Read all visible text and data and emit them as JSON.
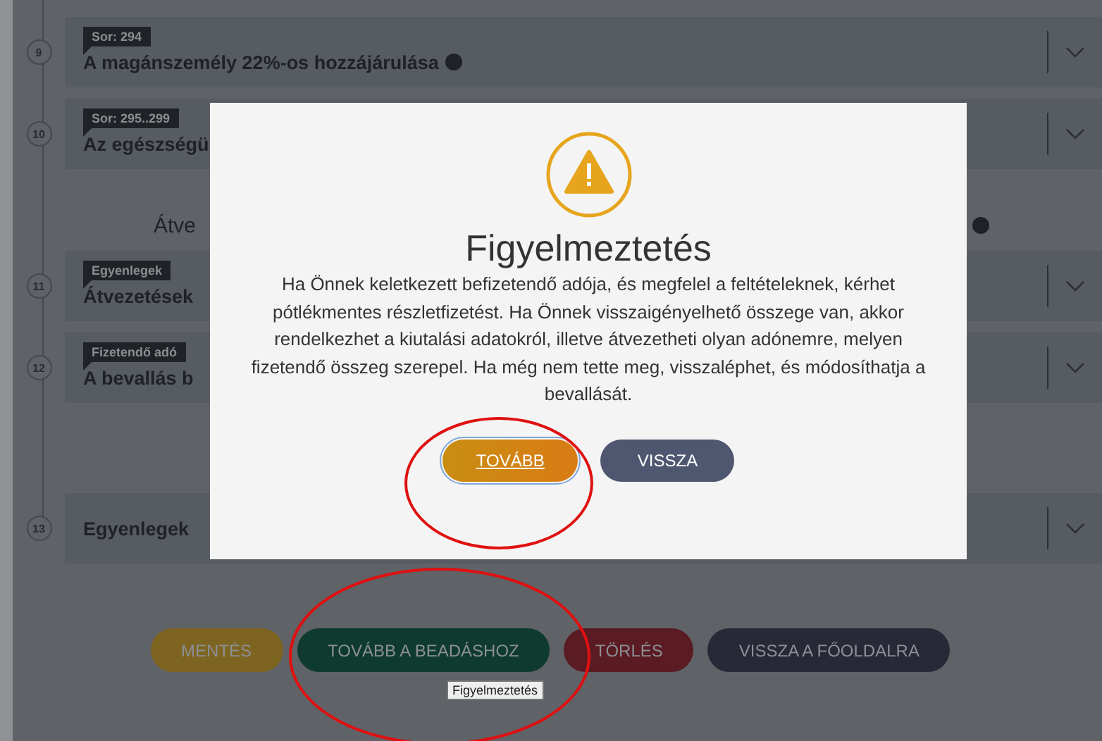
{
  "items": [
    {
      "kind": "section",
      "number": "9",
      "tag": "Sor: 294",
      "title": "A magánszemély 22%-os hozzájárulása",
      "info": true
    },
    {
      "kind": "section",
      "number": "10",
      "tag": "Sor: 295..299",
      "title": "Az egészségü",
      "info": false
    },
    {
      "kind": "note",
      "text": "Átve",
      "info": true
    },
    {
      "kind": "section",
      "number": "11",
      "tag": "Egyenlegek",
      "title": "Átvezetések",
      "info": false
    },
    {
      "kind": "section",
      "number": "12",
      "tag": "Fizetendő adó",
      "title": "A bevallás b",
      "info": false
    },
    {
      "kind": "section",
      "number": "13",
      "title": "Egyenlegek",
      "info": false
    }
  ],
  "actions": [
    {
      "label": "MENTÉS",
      "color": "#7d6420"
    },
    {
      "label": "TOVÁBB A BEADÁSHOZ",
      "color": "#0e3b2d"
    },
    {
      "label": "TÖRLÉS",
      "color": "#5a1b22"
    },
    {
      "label": "VISSZA A FŐOLDALRA",
      "color": "#272a36"
    }
  ],
  "tooltip": "Figyelmeztetés",
  "dialog": {
    "title": "Figyelmeztetés",
    "message": "Ha Önnek keletkezett befizetendő adója, és megfelel a feltételeknek, kérhet pótlékmentes részletfizetést. Ha Önnek visszaigényelhető összege van, akkor rendelkezhet a kiutalási adatokról, illetve átvezetheti olyan adónemre, melyen fizetendő összeg szerepel. Ha még nem tette meg, visszaléphet, és módosíthatja a bevallását.",
    "buttons": [
      {
        "label": "TOVÁBB",
        "kind": "primary",
        "focused": true
      },
      {
        "label": "VISSZA",
        "kind": "secondary",
        "focused": false
      }
    ]
  },
  "annotations": [
    {
      "kind": "ellipse"
    },
    {
      "kind": "ellipse"
    }
  ]
}
